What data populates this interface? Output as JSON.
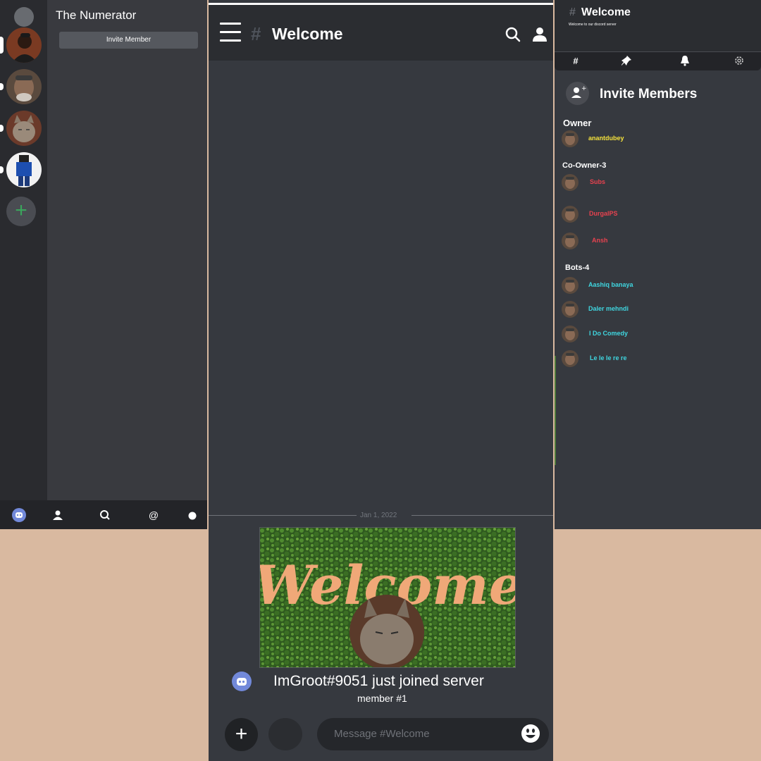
{
  "left": {
    "server_name": "The Numerator",
    "invite_label": "Invite Member",
    "guilds": [
      "man-avatar",
      "old-man-avatar",
      "cat-avatar",
      "blue-shirt-avatar"
    ],
    "bottom_nav": [
      "discord-icon",
      "friends-icon",
      "search-icon",
      "mention-icon",
      "status-icon"
    ],
    "bottom_mention": "@"
  },
  "center": {
    "channel_hash": "#",
    "channel_title": "Welcome",
    "date": "Jan 1, 2022",
    "card_text": "Welcome",
    "join_text": "ImGroot#9051 just joined server",
    "member_text": "member #1",
    "add_label": "+",
    "message_placeholder": "Message #Welcome"
  },
  "right": {
    "hash": "#",
    "title": "Welcome",
    "subtitle": "Welcome to our discord server",
    "tabs": [
      "hash-icon",
      "pin-icon",
      "bell-icon",
      "gear-icon"
    ],
    "tab_hash": "#",
    "invite_title": "Invite Members",
    "roles": [
      {
        "name": "Owner",
        "members": [
          {
            "name": "anantdubey",
            "color": "#f5e23c"
          }
        ]
      },
      {
        "name": "Co-Owner-3",
        "members": [
          {
            "name": "Subs",
            "color": "#e8424f"
          },
          {
            "name": "DurgaIPS",
            "color": "#e8424f"
          },
          {
            "name": "Ansh",
            "color": "#e8424f"
          }
        ]
      },
      {
        "name": "Bots-4",
        "members": [
          {
            "name": "Aashiq banaya",
            "color": "#3fd6e0"
          },
          {
            "name": "Daler mehndi",
            "color": "#3fd6e0"
          },
          {
            "name": "I Do Comedy",
            "color": "#3fd6e0"
          },
          {
            "name": "Le le le re re",
            "color": "#3fd6e0"
          }
        ]
      }
    ]
  },
  "colors": {
    "background": "#d9b9a0",
    "panel": "#36393f",
    "header": "#2b2d31",
    "accent": "#7289da",
    "add_green": "#3ba55c"
  }
}
